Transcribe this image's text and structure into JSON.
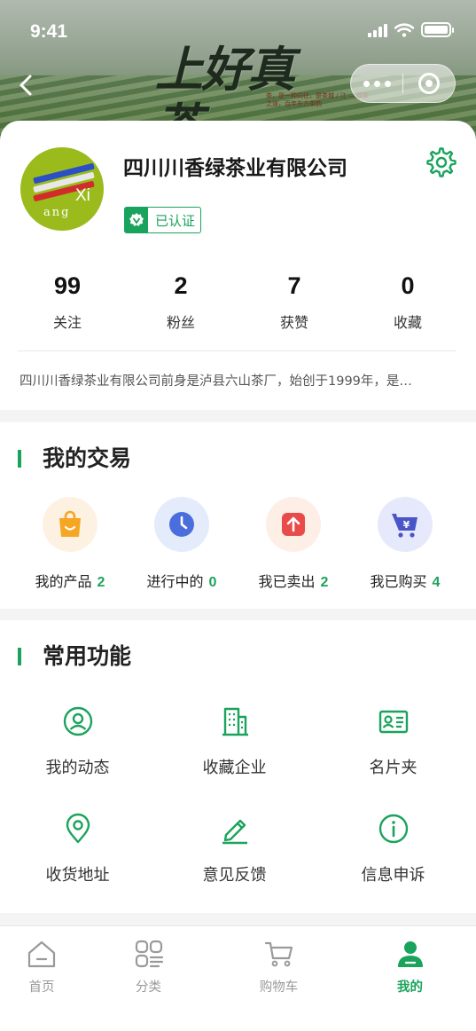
{
  "status_bar": {
    "time": "9:41"
  },
  "banner": {
    "title": "上好真茶",
    "caption": "茶，是一种向往，是茶城 / 江 — 饮茶之道，百年东方茶韵"
  },
  "profile": {
    "company_name": "四川川香绿茶业有限公司",
    "avatar_text_1": "Xi",
    "avatar_text_2": "ang",
    "verified_label": "已认证",
    "stats": [
      {
        "value": "99",
        "label": "关注"
      },
      {
        "value": "2",
        "label": "粉丝"
      },
      {
        "value": "7",
        "label": "获赞"
      },
      {
        "value": "0",
        "label": "收藏"
      }
    ],
    "intro": "四川川香绿茶业有限公司前身是泸县六山茶厂，始创于1999年，是…"
  },
  "trade": {
    "title": "我的交易",
    "items": [
      {
        "label": "我的产品",
        "count": "2",
        "icon": "shopping-bag-icon",
        "color": "#f5a623",
        "bg": "#fdf1e2"
      },
      {
        "label": "进行中的",
        "count": "0",
        "icon": "clock-icon",
        "color": "#4a6fdc",
        "bg": "#e4ebfb"
      },
      {
        "label": "我已卖出",
        "count": "2",
        "icon": "upload-arrow-icon",
        "color": "#e94b4b",
        "bg": "#fdeee6"
      },
      {
        "label": "我已购买",
        "count": "4",
        "icon": "shopping-cart-yen-icon",
        "color": "#4a56c8",
        "bg": "#e6e9fb"
      }
    ]
  },
  "functions": {
    "title": "常用功能",
    "items": [
      {
        "label": "我的动态",
        "icon": "user-circle-icon"
      },
      {
        "label": "收藏企业",
        "icon": "building-icon"
      },
      {
        "label": "名片夹",
        "icon": "contact-card-icon"
      },
      {
        "label": "收货地址",
        "icon": "location-pin-icon"
      },
      {
        "label": "意见反馈",
        "icon": "pencil-icon"
      },
      {
        "label": "信息申诉",
        "icon": "info-circle-icon"
      }
    ]
  },
  "tabbar": {
    "tabs": [
      {
        "label": "首页",
        "icon": "home-icon",
        "active": false
      },
      {
        "label": "分类",
        "icon": "category-icon",
        "active": false
      },
      {
        "label": "购物车",
        "icon": "cart-icon",
        "active": false
      },
      {
        "label": "我的",
        "icon": "profile-icon",
        "active": true
      }
    ]
  },
  "colors": {
    "accent": "#1aa35c",
    "text": "#222222",
    "muted": "#9a9a9a"
  }
}
